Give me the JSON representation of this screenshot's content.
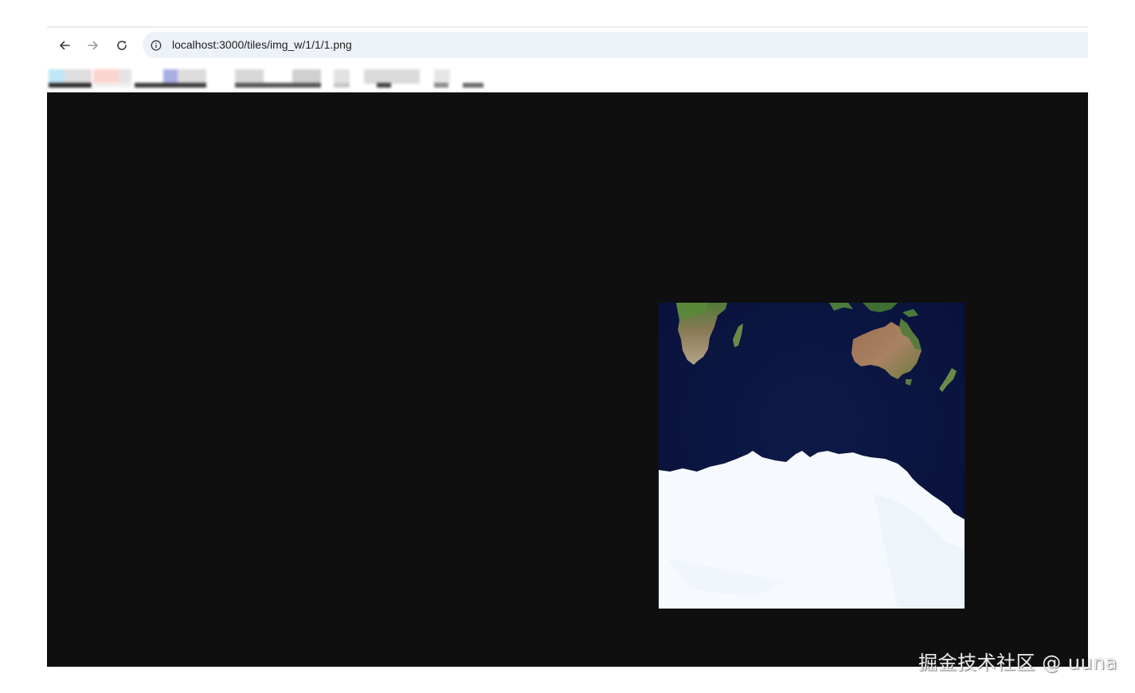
{
  "browser": {
    "url": "localhost:3000/tiles/img_w/1/1/1.png",
    "icons": {
      "back": "arrow-left-icon",
      "forward": "arrow-right-icon",
      "reload": "reload-icon",
      "site_info": "info-icon"
    }
  },
  "bookmarks_bar": {
    "blurred": true
  },
  "viewport": {
    "background": "#0f0f0f",
    "image": {
      "type": "satellite-map-tile",
      "content": "Southern hemisphere: southern Africa, Madagascar, Australia, New Zealand, Indian Ocean, Antarctica"
    }
  },
  "watermark": {
    "text": "掘金技术社区 @ uuna"
  }
}
